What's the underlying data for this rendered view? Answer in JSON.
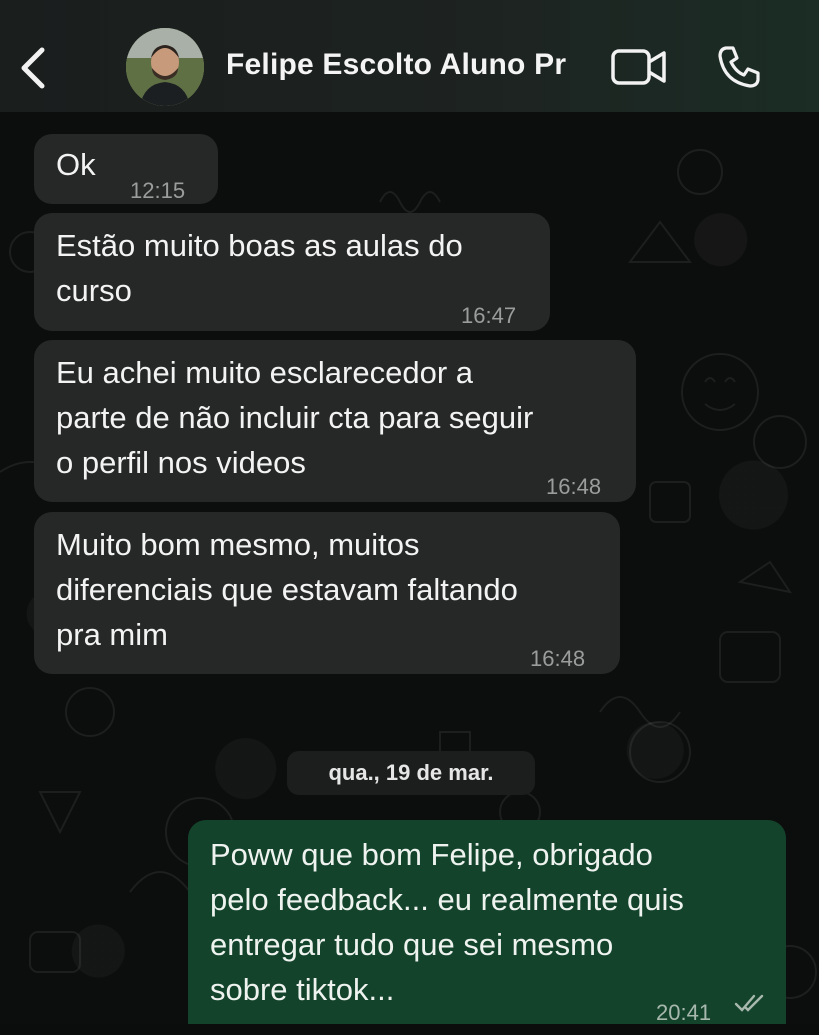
{
  "header": {
    "contact_name": "Felipe Escolto Aluno Pr",
    "back_icon": "chevron-left-icon",
    "video_icon": "video-camera-icon",
    "call_icon": "phone-icon"
  },
  "messages": [
    {
      "text": "Ok",
      "time": "12:15"
    },
    {
      "text": "Estão muito boas as aulas do\ncurso",
      "time": "16:47"
    },
    {
      "text": "Eu achei muito esclarecedor a\nparte de não incluir cta para seguir\no perfil nos videos",
      "time": "16:48"
    },
    {
      "text": "Muito bom mesmo, muitos\ndiferenciais que estavam faltando\npra mim",
      "time": "16:48"
    }
  ],
  "date_separator": "qua., 19 de mar.",
  "outgoing": {
    "text": "Poww que bom Felipe, obrigado\npelo feedback... eu realmente quis\nentregar tudo que sei mesmo\nsobre tiktok...",
    "time": "20:41",
    "status_icon": "double-check-icon"
  },
  "colors": {
    "header_bg": "#1d2321",
    "incoming_bubble": "#262828",
    "outgoing_bubble": "#14432c",
    "background": "#0b0c0c"
  }
}
